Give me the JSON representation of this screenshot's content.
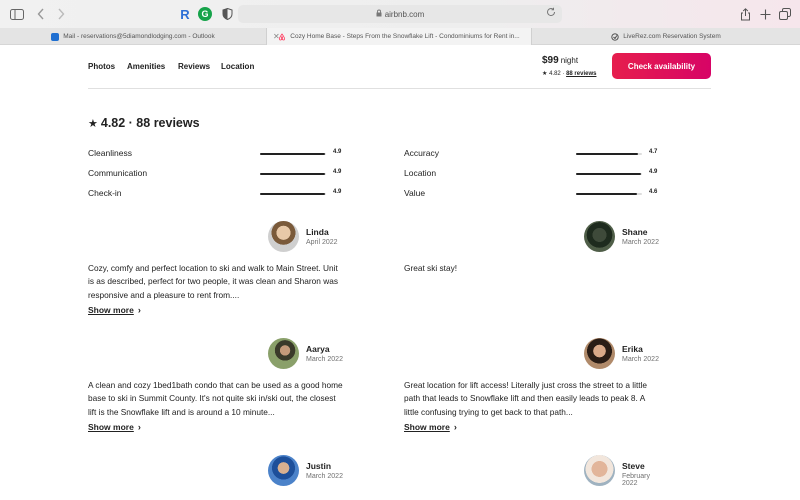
{
  "browser": {
    "address": "airbnb.com",
    "tabs": [
      {
        "label": "Mail - reservations@5diamondlodging.com - Outlook"
      },
      {
        "label": "Cozy Home Base - Steps From the Snowflake Lift - Condominiums for Rent in..."
      },
      {
        "label": "LiveRez.com Reservation System"
      }
    ],
    "icons": {
      "sidebar": "sidebar-icon",
      "back": "chevron-left-icon",
      "forward": "chevron-right-icon",
      "ext1": "R",
      "ext2": "G",
      "share": "share-icon",
      "new_tab": "plus-icon",
      "tab_overview": "tabs-icon"
    }
  },
  "nav": {
    "photos": "Photos",
    "amenities": "Amenities",
    "reviews": "Reviews",
    "location": "Location"
  },
  "booking": {
    "price": "$99",
    "per": "night",
    "rating": "4.82",
    "review_count_link": "88 reviews",
    "cta_label": "Check availability",
    "cta_color": "#e31c5f"
  },
  "reviews_summary": {
    "heading": "4.82 · 88 reviews",
    "categories": [
      {
        "label": "Cleanliness",
        "score": "4.9",
        "value": 4.9
      },
      {
        "label": "Accuracy",
        "score": "4.7",
        "value": 4.7
      },
      {
        "label": "Communication",
        "score": "4.9",
        "value": 4.9
      },
      {
        "label": "Location",
        "score": "4.9",
        "value": 4.9
      },
      {
        "label": "Check-in",
        "score": "4.9",
        "value": 4.9
      },
      {
        "label": "Value",
        "score": "4.6",
        "value": 4.6
      }
    ]
  },
  "reviews": [
    {
      "name": "Linda",
      "date": "April 2022",
      "text": "Cozy, comfy and perfect location to ski and walk to Main Street. Unit is as described, perfect for two people, it was clean and Sharon was responsive and a pleasure to rent from....",
      "show_more": "Show more"
    },
    {
      "name": "Shane",
      "date": "March 2022",
      "text": "Great ski stay!",
      "show_more": ""
    },
    {
      "name": "Aarya",
      "date": "March 2022",
      "text": "A clean and cozy 1bed1bath condo that can be used as a good home base to ski in Summit County. It's not quite ski in/ski out, the closest lift is the Snowflake lift and is around a 10 minute...",
      "show_more": "Show more"
    },
    {
      "name": "Erika",
      "date": "March 2022",
      "text": "Great location for lift access! Literally just cross the street to a little path that leads to Snowflake lift and then easily leads to peak 8. A little confusing trying to get back to that path...",
      "show_more": "Show more"
    },
    {
      "name": "Justin",
      "date": "March 2022",
      "text": "",
      "show_more": ""
    },
    {
      "name": "Steve",
      "date": "February 2022",
      "text": "",
      "show_more": ""
    }
  ]
}
